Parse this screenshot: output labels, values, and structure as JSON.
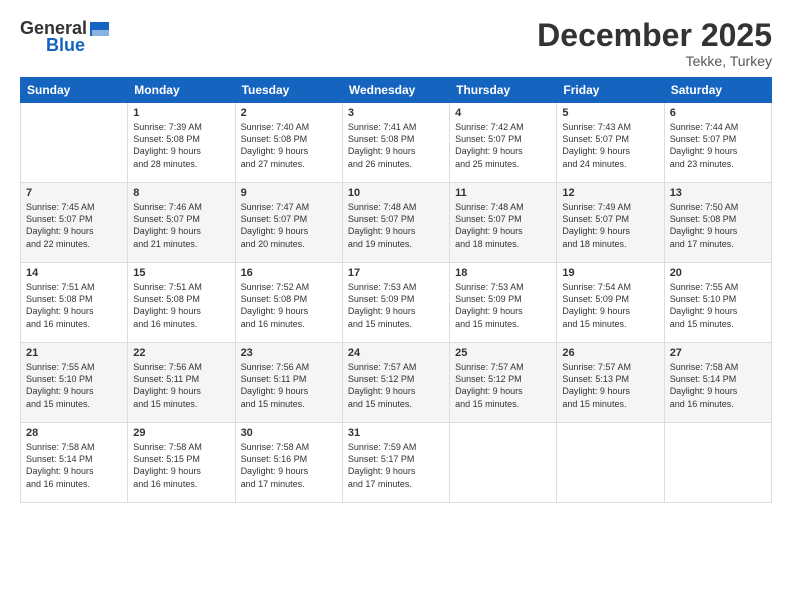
{
  "header": {
    "logo_general": "General",
    "logo_blue": "Blue",
    "title": "December 2025",
    "subtitle": "Tekke, Turkey"
  },
  "weekdays": [
    "Sunday",
    "Monday",
    "Tuesday",
    "Wednesday",
    "Thursday",
    "Friday",
    "Saturday"
  ],
  "weeks": [
    [
      {
        "day": "",
        "info": ""
      },
      {
        "day": "1",
        "info": "Sunrise: 7:39 AM\nSunset: 5:08 PM\nDaylight: 9 hours\nand 28 minutes."
      },
      {
        "day": "2",
        "info": "Sunrise: 7:40 AM\nSunset: 5:08 PM\nDaylight: 9 hours\nand 27 minutes."
      },
      {
        "day": "3",
        "info": "Sunrise: 7:41 AM\nSunset: 5:08 PM\nDaylight: 9 hours\nand 26 minutes."
      },
      {
        "day": "4",
        "info": "Sunrise: 7:42 AM\nSunset: 5:07 PM\nDaylight: 9 hours\nand 25 minutes."
      },
      {
        "day": "5",
        "info": "Sunrise: 7:43 AM\nSunset: 5:07 PM\nDaylight: 9 hours\nand 24 minutes."
      },
      {
        "day": "6",
        "info": "Sunrise: 7:44 AM\nSunset: 5:07 PM\nDaylight: 9 hours\nand 23 minutes."
      }
    ],
    [
      {
        "day": "7",
        "info": "Sunrise: 7:45 AM\nSunset: 5:07 PM\nDaylight: 9 hours\nand 22 minutes."
      },
      {
        "day": "8",
        "info": "Sunrise: 7:46 AM\nSunset: 5:07 PM\nDaylight: 9 hours\nand 21 minutes."
      },
      {
        "day": "9",
        "info": "Sunrise: 7:47 AM\nSunset: 5:07 PM\nDaylight: 9 hours\nand 20 minutes."
      },
      {
        "day": "10",
        "info": "Sunrise: 7:48 AM\nSunset: 5:07 PM\nDaylight: 9 hours\nand 19 minutes."
      },
      {
        "day": "11",
        "info": "Sunrise: 7:48 AM\nSunset: 5:07 PM\nDaylight: 9 hours\nand 18 minutes."
      },
      {
        "day": "12",
        "info": "Sunrise: 7:49 AM\nSunset: 5:07 PM\nDaylight: 9 hours\nand 18 minutes."
      },
      {
        "day": "13",
        "info": "Sunrise: 7:50 AM\nSunset: 5:08 PM\nDaylight: 9 hours\nand 17 minutes."
      }
    ],
    [
      {
        "day": "14",
        "info": "Sunrise: 7:51 AM\nSunset: 5:08 PM\nDaylight: 9 hours\nand 16 minutes."
      },
      {
        "day": "15",
        "info": "Sunrise: 7:51 AM\nSunset: 5:08 PM\nDaylight: 9 hours\nand 16 minutes."
      },
      {
        "day": "16",
        "info": "Sunrise: 7:52 AM\nSunset: 5:08 PM\nDaylight: 9 hours\nand 16 minutes."
      },
      {
        "day": "17",
        "info": "Sunrise: 7:53 AM\nSunset: 5:09 PM\nDaylight: 9 hours\nand 15 minutes."
      },
      {
        "day": "18",
        "info": "Sunrise: 7:53 AM\nSunset: 5:09 PM\nDaylight: 9 hours\nand 15 minutes."
      },
      {
        "day": "19",
        "info": "Sunrise: 7:54 AM\nSunset: 5:09 PM\nDaylight: 9 hours\nand 15 minutes."
      },
      {
        "day": "20",
        "info": "Sunrise: 7:55 AM\nSunset: 5:10 PM\nDaylight: 9 hours\nand 15 minutes."
      }
    ],
    [
      {
        "day": "21",
        "info": "Sunrise: 7:55 AM\nSunset: 5:10 PM\nDaylight: 9 hours\nand 15 minutes."
      },
      {
        "day": "22",
        "info": "Sunrise: 7:56 AM\nSunset: 5:11 PM\nDaylight: 9 hours\nand 15 minutes."
      },
      {
        "day": "23",
        "info": "Sunrise: 7:56 AM\nSunset: 5:11 PM\nDaylight: 9 hours\nand 15 minutes."
      },
      {
        "day": "24",
        "info": "Sunrise: 7:57 AM\nSunset: 5:12 PM\nDaylight: 9 hours\nand 15 minutes."
      },
      {
        "day": "25",
        "info": "Sunrise: 7:57 AM\nSunset: 5:12 PM\nDaylight: 9 hours\nand 15 minutes."
      },
      {
        "day": "26",
        "info": "Sunrise: 7:57 AM\nSunset: 5:13 PM\nDaylight: 9 hours\nand 15 minutes."
      },
      {
        "day": "27",
        "info": "Sunrise: 7:58 AM\nSunset: 5:14 PM\nDaylight: 9 hours\nand 16 minutes."
      }
    ],
    [
      {
        "day": "28",
        "info": "Sunrise: 7:58 AM\nSunset: 5:14 PM\nDaylight: 9 hours\nand 16 minutes."
      },
      {
        "day": "29",
        "info": "Sunrise: 7:58 AM\nSunset: 5:15 PM\nDaylight: 9 hours\nand 16 minutes."
      },
      {
        "day": "30",
        "info": "Sunrise: 7:58 AM\nSunset: 5:16 PM\nDaylight: 9 hours\nand 17 minutes."
      },
      {
        "day": "31",
        "info": "Sunrise: 7:59 AM\nSunset: 5:17 PM\nDaylight: 9 hours\nand 17 minutes."
      },
      {
        "day": "",
        "info": ""
      },
      {
        "day": "",
        "info": ""
      },
      {
        "day": "",
        "info": ""
      }
    ]
  ]
}
